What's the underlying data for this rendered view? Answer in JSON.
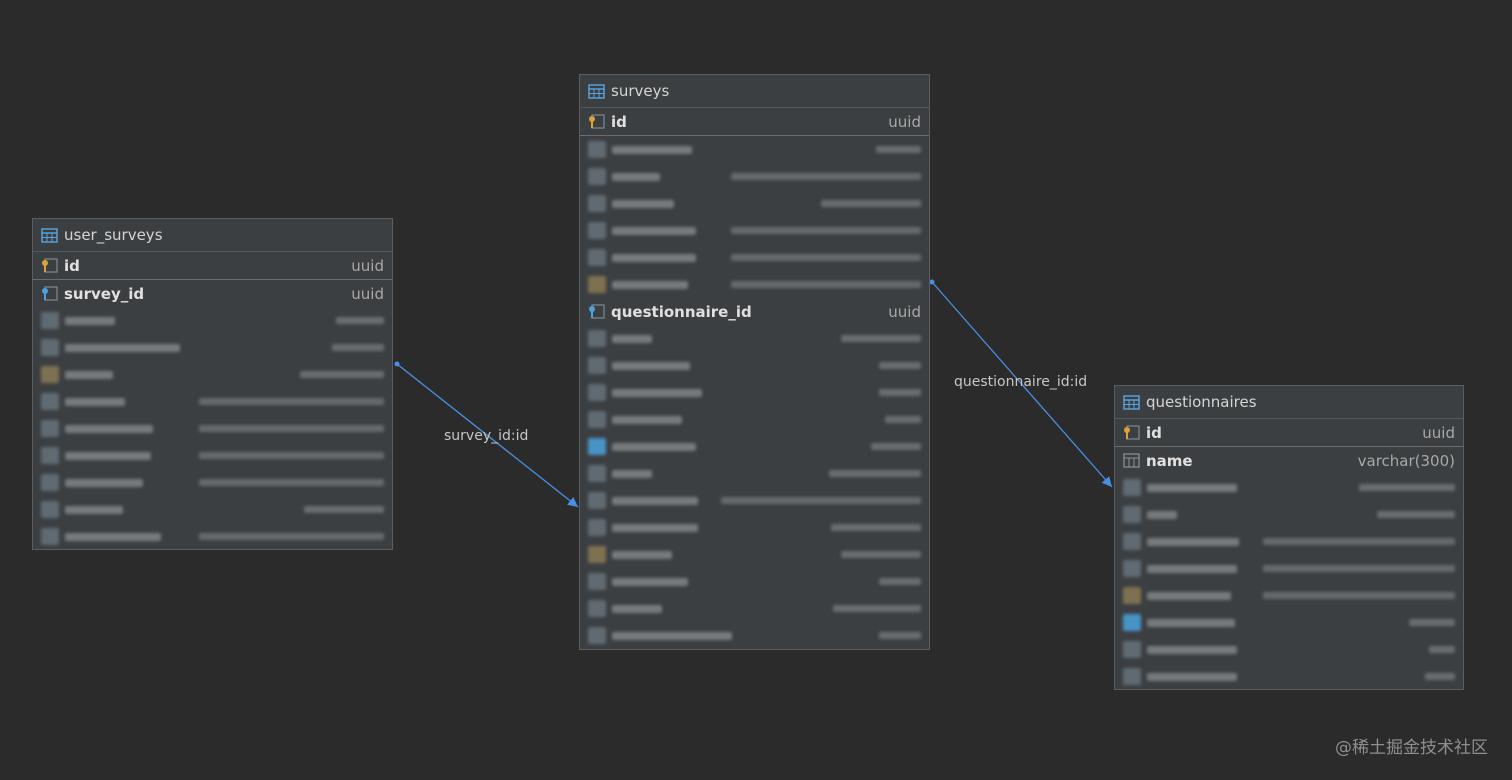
{
  "tables": {
    "user_surveys": {
      "title": "user_surveys",
      "columns": [
        {
          "name": "id",
          "type": "uuid"
        },
        {
          "name": "survey_id",
          "type": "uuid"
        }
      ]
    },
    "surveys": {
      "title": "surveys",
      "columns": [
        {
          "name": "id",
          "type": "uuid"
        },
        {
          "name": "questionnaire_id",
          "type": "uuid"
        }
      ]
    },
    "questionnaires": {
      "title": "questionnaires",
      "columns": [
        {
          "name": "id",
          "type": "uuid"
        },
        {
          "name": "name",
          "type": "varchar(300)"
        }
      ]
    }
  },
  "relations": {
    "survey": "survey_id:id",
    "questionnaire": "questionnaire_id:id"
  },
  "colors": {
    "background": "#2b2b2b",
    "table_body": "#3c3f41",
    "link": "#4a90e2",
    "key_gold": "#d9a33a",
    "key_blue": "#4aa3df"
  },
  "watermark": "@稀土掘金技术社区"
}
